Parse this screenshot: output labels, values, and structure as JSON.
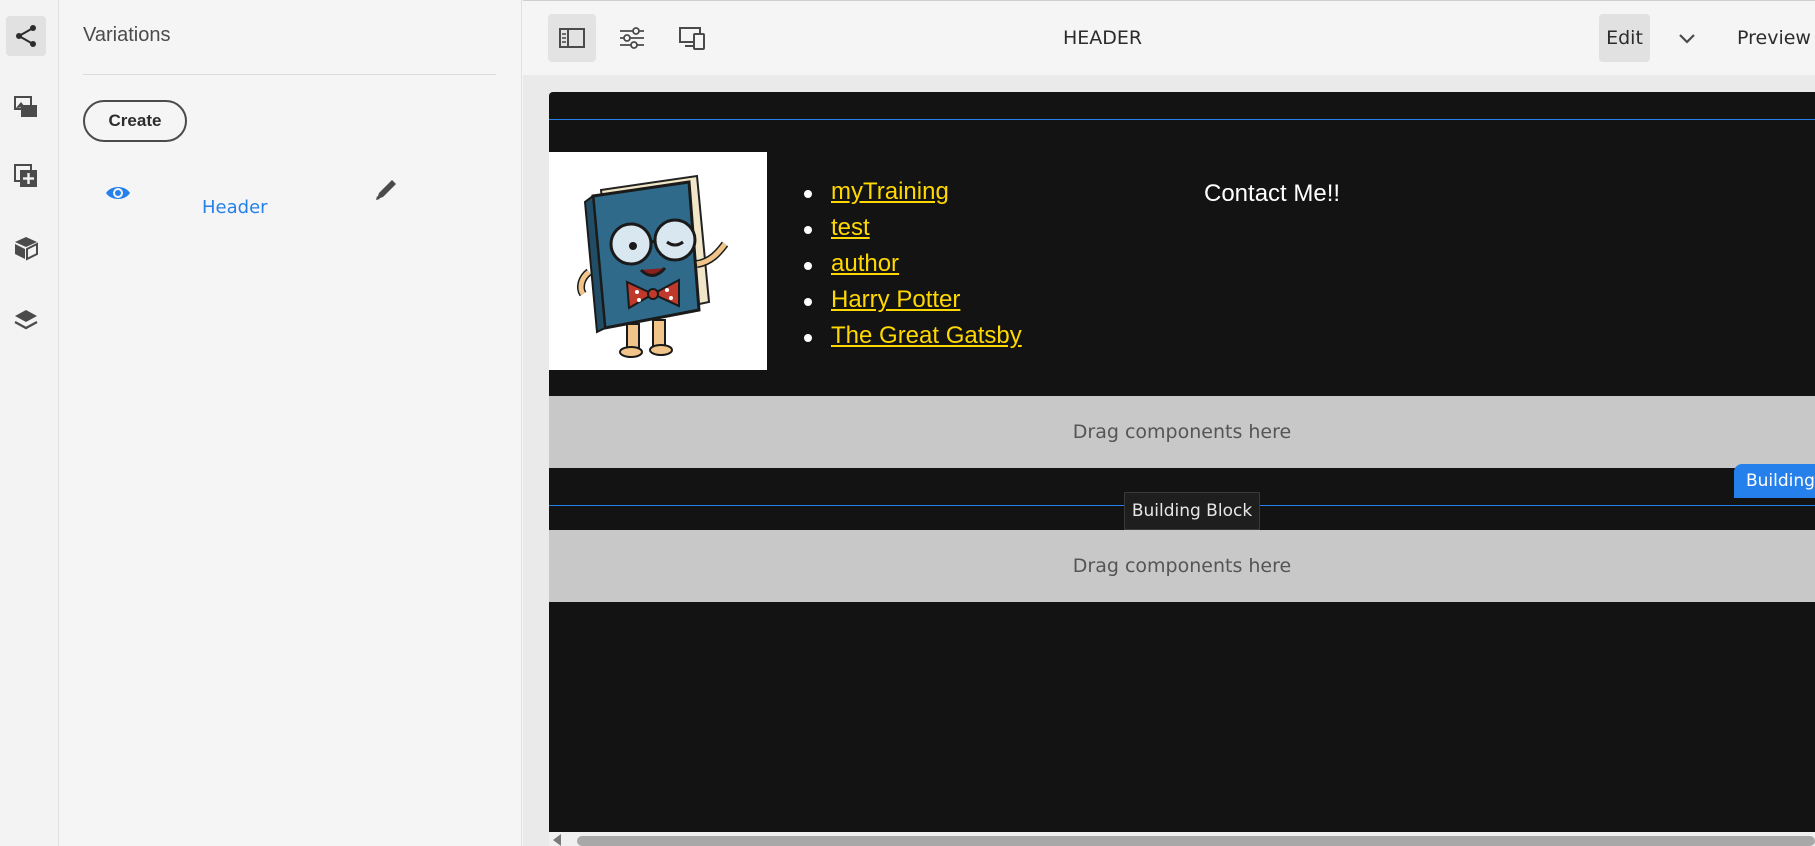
{
  "rail": {
    "items": [
      {
        "name": "share-icon",
        "active": true
      },
      {
        "name": "assets-icon"
      },
      {
        "name": "add-component-icon"
      },
      {
        "name": "content-fragment-icon"
      },
      {
        "name": "layers-icon"
      }
    ]
  },
  "panel": {
    "title": "Variations",
    "create_label": "Create",
    "variations": [
      {
        "label": "Header",
        "icon": "eye-icon"
      }
    ]
  },
  "toolbar": {
    "title": "HEADER",
    "edit_label": "Edit",
    "preview_label": "Preview",
    "icons": [
      "toggle-side-panel-icon",
      "page-properties-icon",
      "emulator-icon"
    ]
  },
  "canvas": {
    "nav_links": [
      "myTraining",
      "test",
      "author",
      "Harry Potter",
      "The Great Gatsby"
    ],
    "contact_text": "Contact Me!!",
    "dropzone_text": "Drag components here",
    "badge_text": "Building Block",
    "tooltip_text": "Building Block"
  },
  "colors": {
    "accent": "#2680eb",
    "link": "#ffd800",
    "canvas_bg": "#131313"
  }
}
